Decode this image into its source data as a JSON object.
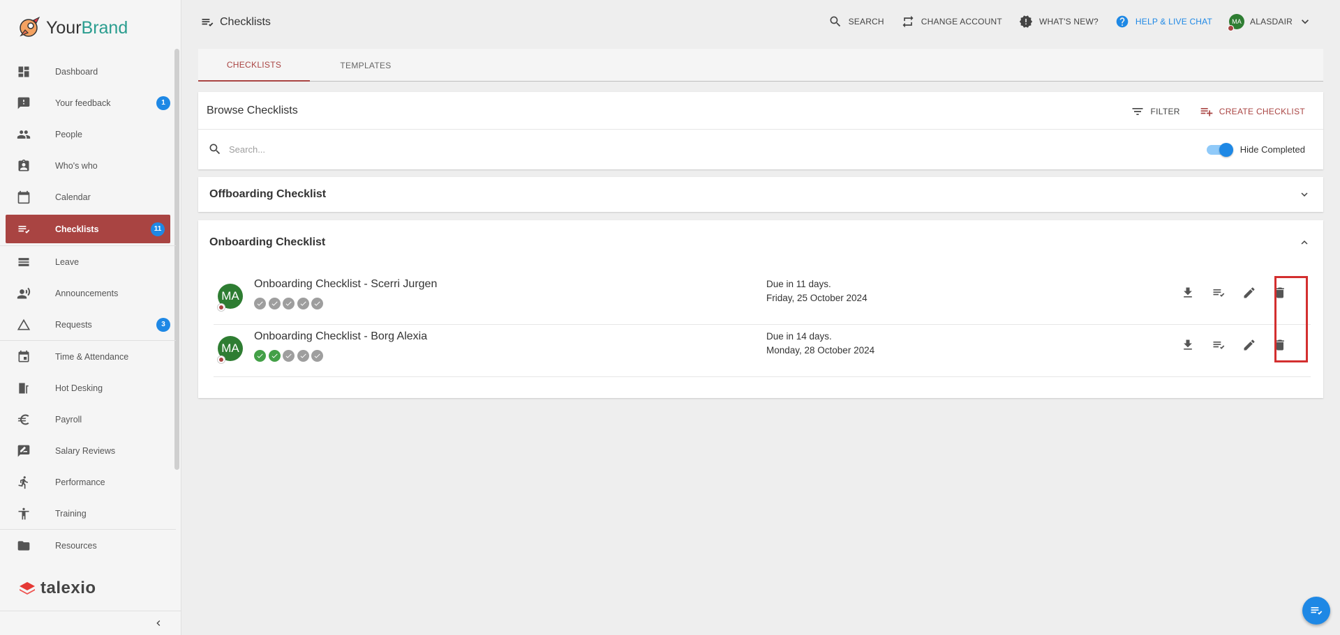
{
  "brand": {
    "name_part1": "Your",
    "name_part2": "Brand"
  },
  "sidebar": {
    "items": [
      {
        "label": "Dashboard",
        "icon": "dashboard-icon"
      },
      {
        "label": "Your feedback",
        "icon": "feedback-icon",
        "badge": "1"
      },
      {
        "label": "People",
        "icon": "people-icon"
      },
      {
        "label": "Who's who",
        "icon": "contact-badge-icon"
      },
      {
        "label": "Calendar",
        "icon": "calendar-icon"
      },
      {
        "label": "Checklists",
        "icon": "checklist-icon",
        "badge": "11",
        "active": true
      },
      {
        "label": "Leave",
        "icon": "leave-icon"
      },
      {
        "label": "Announcements",
        "icon": "announcement-icon"
      },
      {
        "label": "Requests",
        "icon": "triangle-icon",
        "badge": "3"
      },
      {
        "label": "Time & Attendance",
        "icon": "event-icon"
      },
      {
        "label": "Hot Desking",
        "icon": "desk-icon"
      },
      {
        "label": "Payroll",
        "icon": "euro-icon"
      },
      {
        "label": "Salary Reviews",
        "icon": "review-icon"
      },
      {
        "label": "Performance",
        "icon": "run-icon"
      },
      {
        "label": "Training",
        "icon": "accessibility-icon"
      },
      {
        "label": "Resources",
        "icon": "folder-icon"
      }
    ],
    "footer_logo": "talexio"
  },
  "header": {
    "title": "Checklists",
    "actions": {
      "search": "SEARCH",
      "change_account": "CHANGE ACCOUNT",
      "whats_new": "WHAT'S NEW?",
      "help": "HELP & LIVE CHAT",
      "user": "ALASDAIR",
      "user_initials": "MA"
    }
  },
  "tabs": [
    {
      "label": "CHECKLISTS",
      "active": true
    },
    {
      "label": "TEMPLATES",
      "active": false
    }
  ],
  "browse": {
    "title": "Browse Checklists",
    "filter_label": "FILTER",
    "create_label": "CREATE CHECKLIST",
    "search_placeholder": "Search...",
    "search_value": "",
    "hide_completed_label": "Hide Completed",
    "hide_completed_on": true
  },
  "sections": {
    "offboarding": {
      "title": "Offboarding Checklist",
      "expanded": false
    },
    "onboarding": {
      "title": "Onboarding Checklist",
      "expanded": true,
      "rows": [
        {
          "initials": "MA",
          "name": "Onboarding Checklist - Scerri Jurgen",
          "checks_done": 0,
          "checks_total": 5,
          "due_line1": "Due in 11 days.",
          "due_line2": "Friday, 25 October 2024"
        },
        {
          "initials": "MA",
          "name": "Onboarding Checklist - Borg Alexia",
          "checks_done": 2,
          "checks_total": 5,
          "due_line1": "Due in 14 days.",
          "due_line2": "Monday, 28 October 2024"
        }
      ]
    }
  },
  "colors": {
    "accent": "#a94442",
    "primary": "#1e88e5",
    "success": "#43a047",
    "avatar": "#2e7d32",
    "highlight": "#d32f2f"
  }
}
